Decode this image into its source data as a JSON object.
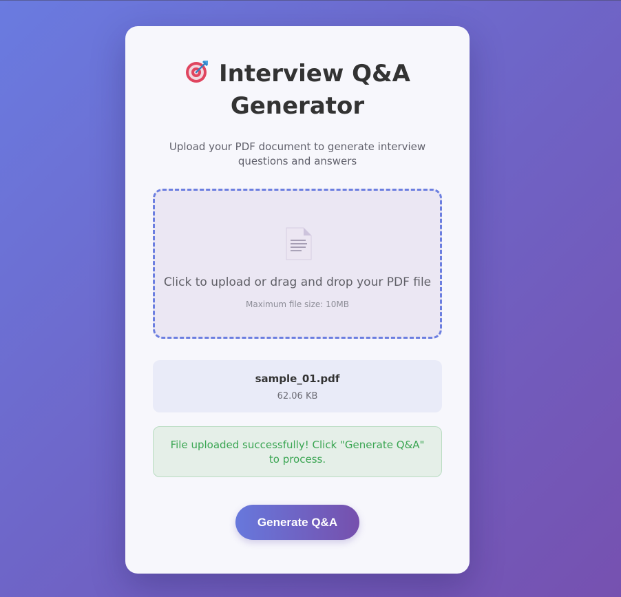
{
  "app": {
    "title": "Interview Q&A Generator",
    "title_icon": "target-icon",
    "subtitle": "Upload your PDF document to generate interview questions and answers"
  },
  "upload": {
    "icon": "document-icon",
    "prompt": "Click to upload or drag and drop your PDF file",
    "hint": "Maximum file size: 10MB"
  },
  "file": {
    "name": "sample_01.pdf",
    "size": "62.06 KB"
  },
  "status": {
    "message": "File uploaded successfully! Click \"Generate Q&A\" to process."
  },
  "actions": {
    "generate_label": "Generate Q&A"
  },
  "colors": {
    "accent": "#6b7ee0",
    "accent_end": "#7650ad",
    "success": "#3aa552"
  }
}
